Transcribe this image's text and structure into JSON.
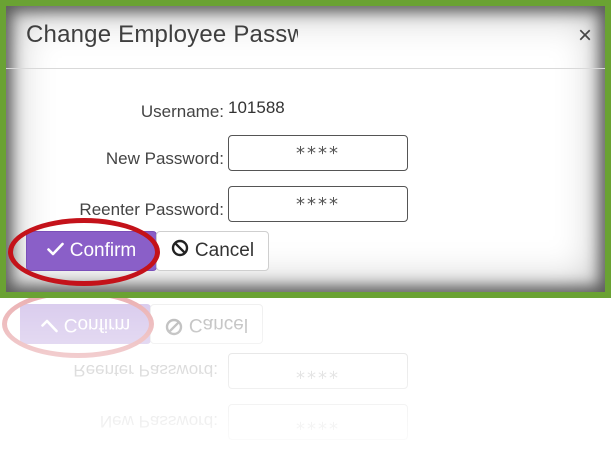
{
  "dialog": {
    "title": "Change Employee Passw",
    "close_glyph": "×",
    "username_label": "Username:",
    "username_value": "101588",
    "new_password_label": "New Password:",
    "new_password_value": "****",
    "reenter_password_label": "Reenter Password:",
    "reenter_password_value": "****",
    "confirm_label": "Confirm",
    "confirm_icon": "check-icon",
    "cancel_label": "Cancel",
    "cancel_icon": "ban-icon"
  },
  "colors": {
    "frame_green": "#6aa233",
    "confirm_purple": "#8a5fc8",
    "highlight_red": "#c4121a"
  }
}
